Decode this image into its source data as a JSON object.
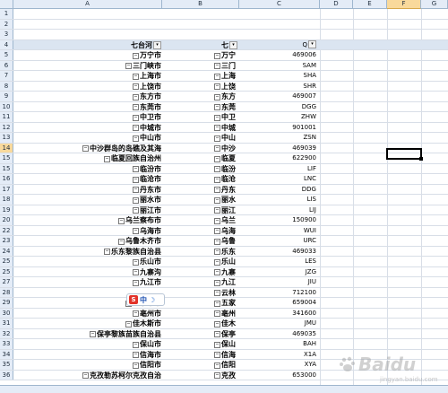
{
  "columns": [
    "A",
    "B",
    "C",
    "D",
    "E",
    "F",
    "G"
  ],
  "selected_column": "F",
  "selected_row": "14",
  "header_row": {
    "row": "4",
    "a_label": "七台河",
    "b_label": "七",
    "c_label": "Q"
  },
  "rows": [
    {
      "n": "1",
      "a": "",
      "b": "",
      "c": "",
      "a_toggle": false,
      "b_toggle": false
    },
    {
      "n": "2",
      "a": "",
      "b": "",
      "c": "",
      "a_toggle": false,
      "b_toggle": false
    },
    {
      "n": "3",
      "a": "",
      "b": "",
      "c": "",
      "a_toggle": false,
      "b_toggle": false
    },
    {
      "n": "5",
      "a": "万宁市",
      "b": "万宁",
      "c": "469006",
      "a_toggle": true,
      "b_toggle": true
    },
    {
      "n": "6",
      "a": "三门峡市",
      "b": "三门",
      "c": "SAM",
      "a_toggle": true,
      "b_toggle": true
    },
    {
      "n": "7",
      "a": "上海市",
      "b": "上海",
      "c": "SHA",
      "a_toggle": true,
      "b_toggle": true
    },
    {
      "n": "8",
      "a": "上饶市",
      "b": "上饶",
      "c": "SHR",
      "a_toggle": true,
      "b_toggle": true
    },
    {
      "n": "9",
      "a": "东方市",
      "b": "东方",
      "c": "469007",
      "a_toggle": true,
      "b_toggle": true
    },
    {
      "n": "10",
      "a": "东莞市",
      "b": "东莞",
      "c": "DGG",
      "a_toggle": true,
      "b_toggle": true
    },
    {
      "n": "11",
      "a": "中卫市",
      "b": "中卫",
      "c": "ZHW",
      "a_toggle": true,
      "b_toggle": true
    },
    {
      "n": "12",
      "a": "中城市",
      "b": "中城",
      "c": "901001",
      "a_toggle": true,
      "b_toggle": true
    },
    {
      "n": "13",
      "a": "中山市",
      "b": "中山",
      "c": "ZSN",
      "a_toggle": true,
      "b_toggle": true
    },
    {
      "n": "14",
      "a": "中沙群岛的岛礁及其海",
      "b": "中沙",
      "c": "469039",
      "a_toggle": true,
      "b_toggle": true
    },
    {
      "n": "15",
      "a": "临夏回族自治州",
      "b": "临夏",
      "c": "622900",
      "a_toggle": true,
      "b_toggle": true
    },
    {
      "n": "15",
      "a": "临汾市",
      "b": "临汾",
      "c": "LIF",
      "a_toggle": true,
      "b_toggle": true
    },
    {
      "n": "16",
      "a": "临沧市",
      "b": "临沧",
      "c": "LNC",
      "a_toggle": true,
      "b_toggle": true
    },
    {
      "n": "17",
      "a": "丹东市",
      "b": "丹东",
      "c": "DDG",
      "a_toggle": true,
      "b_toggle": true
    },
    {
      "n": "18",
      "a": "丽水市",
      "b": "丽水",
      "c": "LIS",
      "a_toggle": true,
      "b_toggle": true
    },
    {
      "n": "19",
      "a": "丽江市",
      "b": "丽江",
      "c": "LIJ",
      "a_toggle": true,
      "b_toggle": true
    },
    {
      "n": "20",
      "a": "乌兰察布市",
      "b": "乌兰",
      "c": "150900",
      "a_toggle": true,
      "b_toggle": true
    },
    {
      "n": "22",
      "a": "乌海市",
      "b": "乌海",
      "c": "WUI",
      "a_toggle": true,
      "b_toggle": true
    },
    {
      "n": "23",
      "a": "乌鲁木齐市",
      "b": "乌鲁",
      "c": "URC",
      "a_toggle": true,
      "b_toggle": true
    },
    {
      "n": "24",
      "a": "乐东黎族自治县",
      "b": "乐东",
      "c": "469033",
      "a_toggle": true,
      "b_toggle": true
    },
    {
      "n": "25",
      "a": "乐山市",
      "b": "乐山",
      "c": "LES",
      "a_toggle": true,
      "b_toggle": true
    },
    {
      "n": "25",
      "a": "九寨沟",
      "b": "九寨",
      "c": "JZG",
      "a_toggle": true,
      "b_toggle": true
    },
    {
      "n": "27",
      "a": "九江市",
      "b": "九江",
      "c": "JIU",
      "a_toggle": true,
      "b_toggle": true
    },
    {
      "n": "28",
      "a": "",
      "b": "云林",
      "c": "712100",
      "a_toggle": false,
      "b_toggle": true
    },
    {
      "n": "29",
      "a": "五家渠市",
      "b": "五家",
      "c": "659004",
      "a_toggle": true,
      "b_toggle": true
    },
    {
      "n": "30",
      "a": "亳州市",
      "b": "亳州",
      "c": "341600",
      "a_toggle": true,
      "b_toggle": true
    },
    {
      "n": "31",
      "a": "佳木斯市",
      "b": "佳木",
      "c": "JMU",
      "a_toggle": true,
      "b_toggle": true
    },
    {
      "n": "32",
      "a": "保亭黎族苗族自治县",
      "b": "保亭",
      "c": "469035",
      "a_toggle": true,
      "b_toggle": true
    },
    {
      "n": "33",
      "a": "保山市",
      "b": "保山",
      "c": "BAH",
      "a_toggle": true,
      "b_toggle": true
    },
    {
      "n": "34",
      "a": "信海市",
      "b": "信海",
      "c": "X1A",
      "a_toggle": true,
      "b_toggle": true
    },
    {
      "n": "35",
      "a": "信阳市",
      "b": "信阳",
      "c": "XYA",
      "a_toggle": true,
      "b_toggle": true
    },
    {
      "n": "36",
      "a": "克孜勒苏柯尔克孜自治",
      "b": "克孜",
      "c": "653000",
      "a_toggle": true,
      "b_toggle": true
    }
  ],
  "ime": {
    "logo": "S",
    "lang": "中",
    "moon": "☽"
  },
  "watermark": {
    "text": "Baidu",
    "sub": "jingyan.baidu.com"
  },
  "colors": {
    "header_bg": "#e4ecf7",
    "grid": "#d8dee7",
    "selected": "#f9d99b"
  }
}
